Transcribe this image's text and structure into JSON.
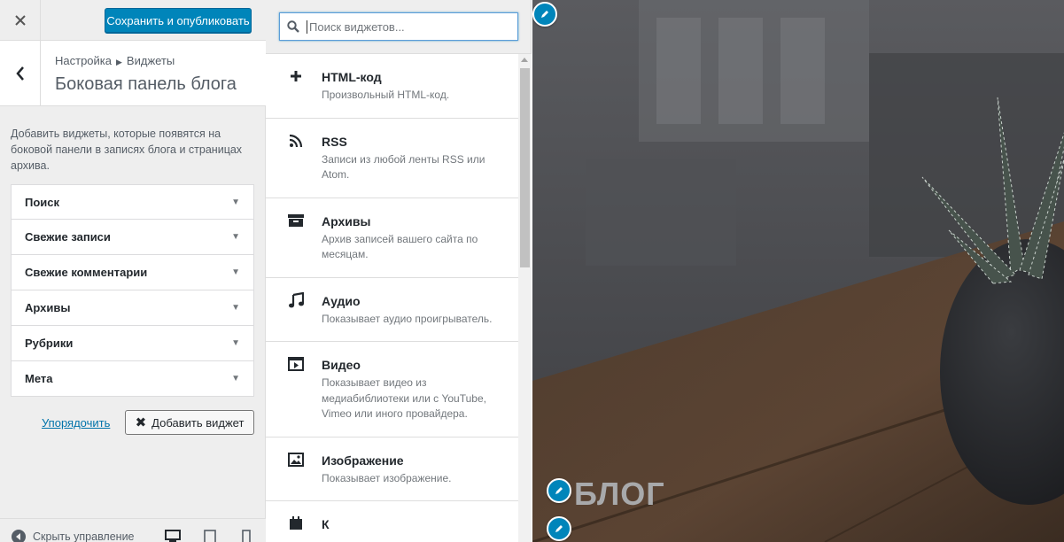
{
  "topbar": {
    "close_icon": "close-icon",
    "publish_label": "Сохранить и опубликовать"
  },
  "section": {
    "breadcrumb_root": "Настройка",
    "breadcrumb_child": "Виджеты",
    "title": "Боковая панель блога",
    "description": "Добавить виджеты, которые появятся на боковой панели в записях блога и страницах архива."
  },
  "sidebar_widgets": [
    {
      "label": "Поиск"
    },
    {
      "label": "Свежие записи"
    },
    {
      "label": "Свежие комментарии"
    },
    {
      "label": "Архивы"
    },
    {
      "label": "Рубрики"
    },
    {
      "label": "Мета"
    }
  ],
  "actions": {
    "reorder_label": "Упорядочить",
    "add_widget_label": "Добавить виджет"
  },
  "footer": {
    "hide_controls_label": "Скрыть управление"
  },
  "search": {
    "placeholder": "Поиск виджетов..."
  },
  "available_widgets": [
    {
      "title": "HTML-код",
      "desc": "Произвольный HTML-код.",
      "icon": "plus-icon"
    },
    {
      "title": "RSS",
      "desc": "Записи из любой ленты RSS или Atom.",
      "icon": "rss-icon"
    },
    {
      "title": "Архивы",
      "desc": "Архив записей вашего сайта по месяцам.",
      "icon": "archive-icon"
    },
    {
      "title": "Аудио",
      "desc": "Показывает аудио проигрыватель.",
      "icon": "music-icon"
    },
    {
      "title": "Видео",
      "desc": "Показывает видео из медиабиблиотеки или с YouTube, Vimeo или иного провайдера.",
      "icon": "video-icon"
    },
    {
      "title": "Изображение",
      "desc": "Показывает изображение.",
      "icon": "image-icon"
    },
    {
      "title": "К",
      "desc": "",
      "icon": "calendar-icon"
    }
  ],
  "preview": {
    "site_title": "БЛОГ"
  },
  "colors": {
    "accent": "#0085ba",
    "link": "#0073aa"
  }
}
